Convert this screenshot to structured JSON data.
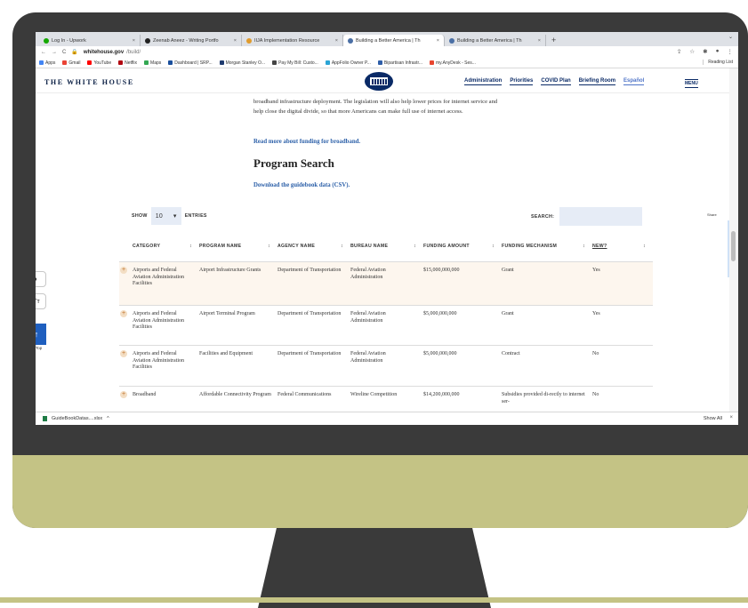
{
  "browser": {
    "tabs": [
      {
        "title": "Log In - Upwork",
        "active": false
      },
      {
        "title": "Zeenab Aneez - Writing Portfo",
        "active": false
      },
      {
        "title": "IIJA Implementation Resource",
        "active": false
      },
      {
        "title": "Building a Better America | Th",
        "active": true
      },
      {
        "title": "Building a Better America | Th",
        "active": false
      }
    ],
    "new_tab": "+",
    "url_host": "whitehouse.gov",
    "url_path": "/build/",
    "bookmarks": [
      "Apps",
      "Gmail",
      "YouTube",
      "Netflix",
      "Maps",
      "Dashboard | SRP...",
      "Morgan Stanley O...",
      "Pay My Bill: Custo...",
      "AppFolio Owner P...",
      "Bipartisan Infrastr...",
      "my.AnyDesk - Ses..."
    ],
    "reading_list": "Reading List"
  },
  "site": {
    "brand": "THE WHITE HOUSE",
    "nav": [
      "Administration",
      "Priorities",
      "COVID Plan",
      "Briefing Room",
      "Español"
    ],
    "menu": "MENU"
  },
  "content": {
    "paragraph": "broadband infrastructure deployment. The legislation will also help lower prices for internet service and help close the digital divide, so that more Americans can make full use of internet access.",
    "read_more": "Read more about funding for broadband.",
    "heading": "Program Search",
    "download": "Download the guidebook data (CSV)."
  },
  "table_controls": {
    "show": "SHOW",
    "entries_value": "10",
    "entries": "ENTRIES",
    "search": "SEARCH:"
  },
  "table": {
    "headers": [
      "CATEGORY",
      "PROGRAM NAME",
      "AGENCY NAME",
      "BUREAU NAME",
      "FUNDING AMOUNT",
      "FUNDING MECHANISM",
      "NEW?"
    ],
    "rows": [
      [
        "Airports and Federal Aviation Administration Facilities",
        "Airport Infrastructure Grants",
        "Department of Transportation",
        "Federal Aviation Administration",
        "$15,000,000,000",
        "Grant",
        "Yes"
      ],
      [
        "Airports and Federal Aviation Administration Facilities",
        "Airport Terminal Program",
        "Department of Transportation",
        "Federal Aviation Administration",
        "$5,000,000,000",
        "Grant",
        "Yes"
      ],
      [
        "Airports and Federal Aviation Administration Facilities",
        "Facilities and Equipment",
        "Department of Transportation",
        "Federal Aviation Administration",
        "$5,000,000,000",
        "Contract",
        "No"
      ],
      [
        "Broadband",
        "Affordable Connectivity Program",
        "Federal Communications",
        "Wireline Competition",
        "$14,200,000,000",
        "Subsidies provided di-rectly to internet ser-",
        "No"
      ]
    ]
  },
  "widgets": {
    "top": "Top",
    "share": "Share"
  },
  "downloads": {
    "file": "GuideBookDatas....xlsx",
    "show_all": "Show All"
  },
  "colors": {
    "monitor": "#3a3a3a",
    "chin": "#c4c385",
    "link": "#2b5fa8",
    "navy": "#0a2a66",
    "row_highlight": "#fdf6ee"
  }
}
